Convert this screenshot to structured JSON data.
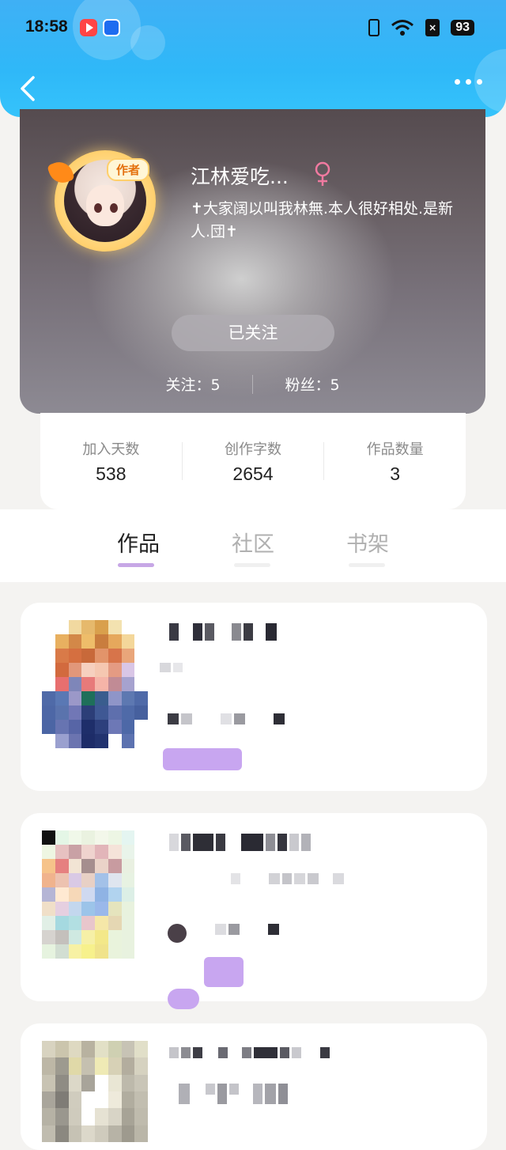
{
  "status_bar": {
    "time": "18:58",
    "battery": "93",
    "icons": [
      "video-app-icon",
      "browser-app-icon",
      "vibrate-icon",
      "wifi-icon",
      "sim-icon",
      "battery-icon"
    ]
  },
  "header": {
    "back_icon": "chevron-left-icon",
    "more_icon": "more-dots-icon"
  },
  "profile": {
    "nickname": "江林爱吃...",
    "gender_icon": "female-icon",
    "author_badge": "作者",
    "bio": "✝大家阔以叫我林無.本人很好相处.是新人.団✝",
    "follow_button": "已关注",
    "following_label": "关注：5",
    "fans_label": "粉丝：5"
  },
  "stats": [
    {
      "label": "加入天数",
      "value": "538"
    },
    {
      "label": "创作字数",
      "value": "2654"
    },
    {
      "label": "作品数量",
      "value": "3"
    }
  ],
  "tabs": [
    {
      "label": "作品",
      "active": true
    },
    {
      "label": "社区",
      "active": false
    },
    {
      "label": "书架",
      "active": false
    }
  ],
  "colors": {
    "header_blue": "#2fb8f8",
    "tab_active_underline": "#c7a7e6",
    "female_pink": "#f07aa0",
    "badge_orange": "#e4700e"
  }
}
